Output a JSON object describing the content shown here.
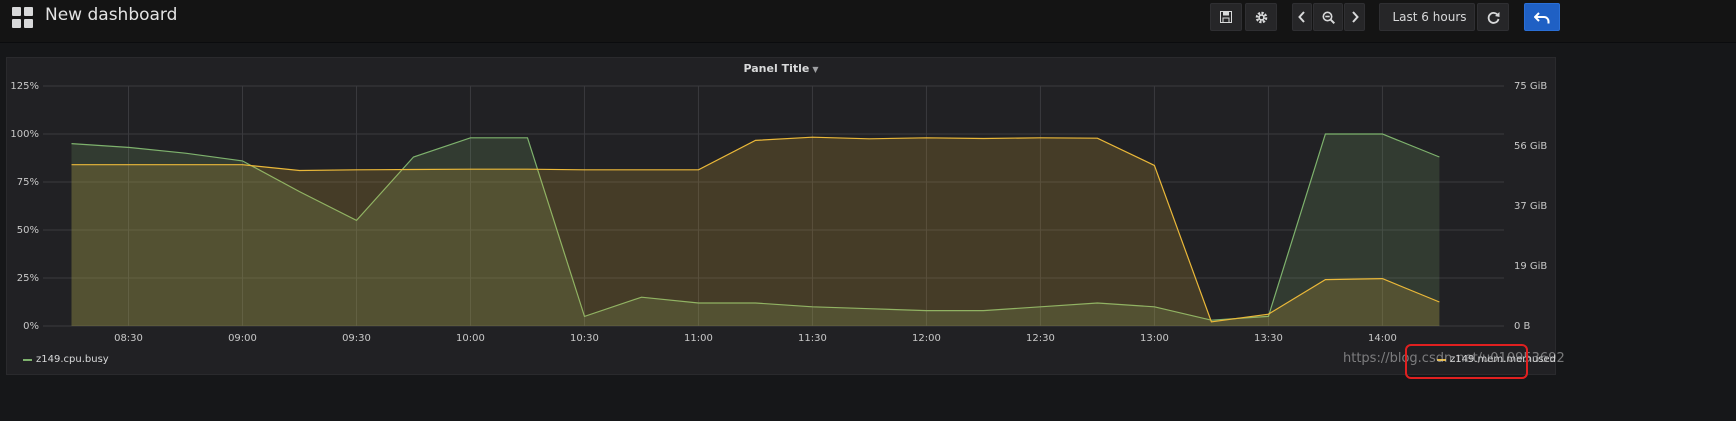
{
  "header": {
    "title": "New dashboard",
    "time_range_label": "Last 6 hours",
    "icons": [
      "grid-logo-icon",
      "save-icon",
      "gear-icon",
      "chevron-left-icon",
      "zoom-out-icon",
      "chevron-right-icon",
      "clock-icon",
      "refresh-icon",
      "back-arrow-icon"
    ]
  },
  "panel": {
    "title": "Panel Title"
  },
  "colors": {
    "cpu_series": "#7eb26d",
    "mem_series": "#eab839",
    "background": "#161719",
    "panel_background": "#212124",
    "accent_button": "#1f60c4",
    "highlight_box": "#e02020"
  },
  "chart_data": {
    "type": "line",
    "title": "Panel Title",
    "x": [
      "08:15",
      "08:30",
      "08:45",
      "09:00",
      "09:15",
      "09:30",
      "09:45",
      "10:00",
      "10:15",
      "10:30",
      "10:45",
      "11:00",
      "11:15",
      "11:30",
      "11:45",
      "12:00",
      "12:15",
      "12:30",
      "12:45",
      "13:00",
      "13:15",
      "13:30",
      "13:45",
      "14:00",
      "14:15"
    ],
    "x_ticks": [
      "08:30",
      "09:00",
      "09:30",
      "10:00",
      "10:30",
      "11:00",
      "11:30",
      "12:00",
      "12:30",
      "13:00",
      "13:30",
      "14:00"
    ],
    "y_left": {
      "ticks": [
        "0%",
        "25%",
        "50%",
        "75%",
        "100%",
        "125%"
      ],
      "range": [
        0,
        125
      ],
      "unit": "%"
    },
    "y_right": {
      "ticks": [
        "0 B",
        "19 GiB",
        "37 GiB",
        "56 GiB",
        "75 GiB"
      ],
      "range_gib": [
        0,
        75
      ]
    },
    "series": [
      {
        "name": "z149.cpu.busy",
        "axis": "left",
        "fill": true,
        "values": [
          95,
          93,
          90,
          86,
          70,
          55,
          88,
          98,
          98,
          5,
          15,
          12,
          12,
          10,
          9,
          8,
          8,
          10,
          12,
          10,
          3,
          5,
          100,
          100,
          88
        ]
      },
      {
        "name": "z149.mem.memused",
        "axis": "right",
        "fill": true,
        "values": [
          50.4,
          50.4,
          50.4,
          50.4,
          48.6,
          48.8,
          48.9,
          49.0,
          49.0,
          48.8,
          48.8,
          48.8,
          58.0,
          59.0,
          58.5,
          58.8,
          58.6,
          58.8,
          58.7,
          50.2,
          1.3,
          3.7,
          14.5,
          14.8,
          7.5
        ]
      }
    ],
    "grid": true,
    "legend_position": "bottom-left"
  },
  "watermark": "https://blog.csdn.net/u010953692"
}
